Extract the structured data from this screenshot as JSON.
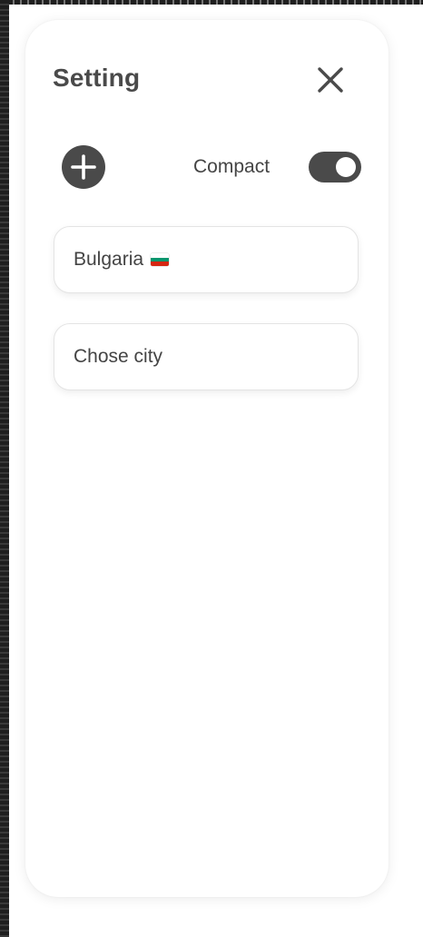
{
  "settings_panel": {
    "title": "Setting",
    "close_icon": "close-icon",
    "add_icon": "plus-circle-icon",
    "compact": {
      "label": "Compact",
      "enabled": true,
      "on_color": "#4a4a4a"
    },
    "country_field": {
      "value": "Bulgaria",
      "flag": "bulgaria-flag-icon",
      "flag_colors": [
        "#ffffff",
        "#00966e",
        "#d62612"
      ]
    },
    "city_field": {
      "placeholder": "Chose city"
    }
  }
}
